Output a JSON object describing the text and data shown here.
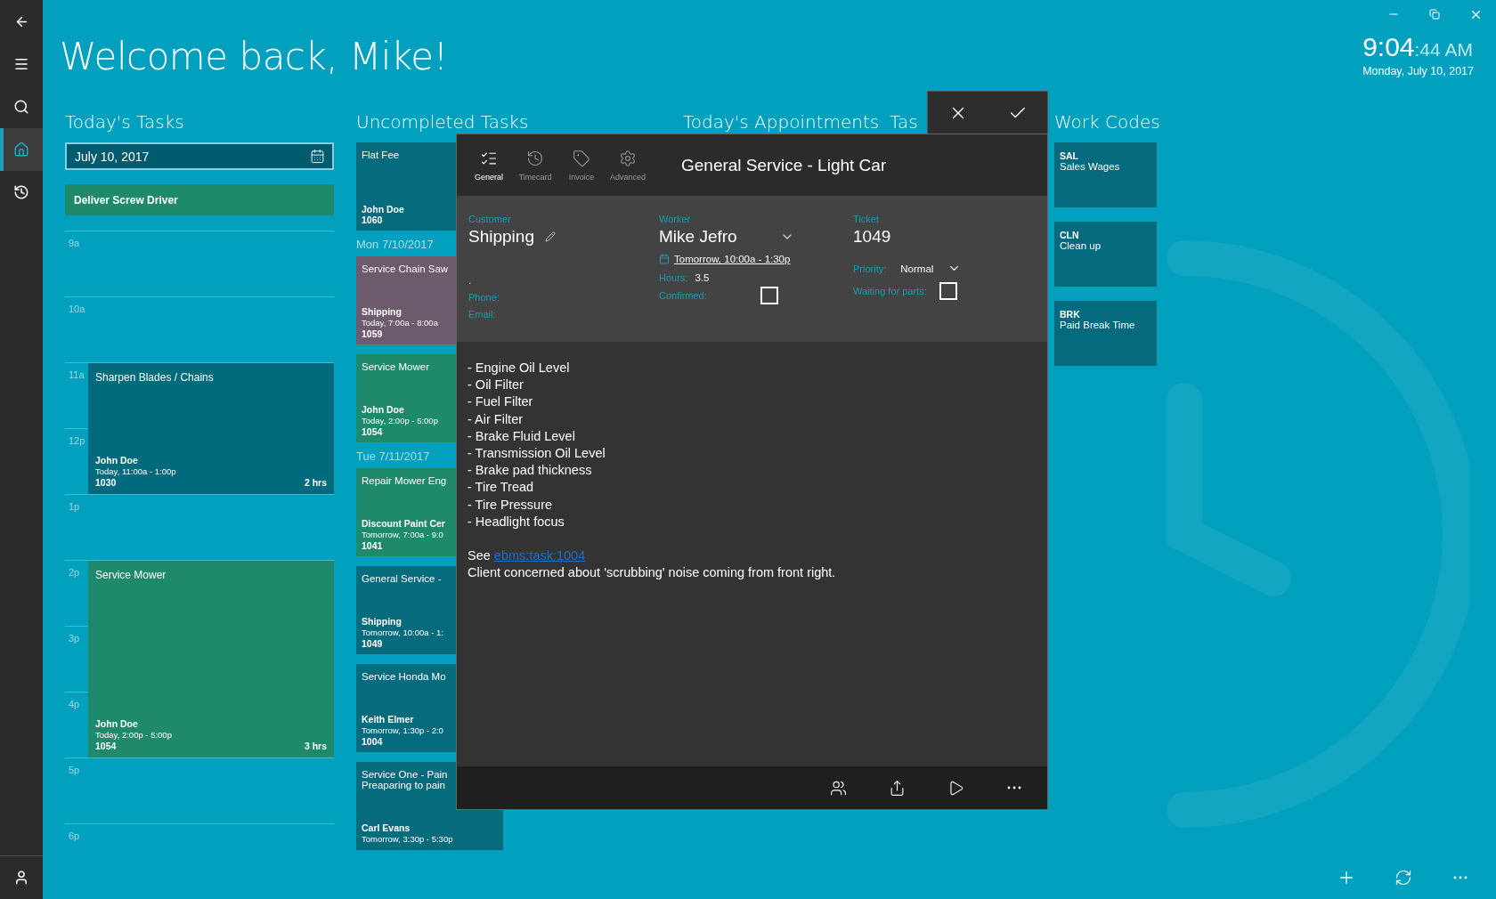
{
  "title": "Welcome back, Mike!",
  "clock": {
    "time": "9:04",
    "seconds": ":44 AM",
    "date": "Monday, July 10, 2017"
  },
  "nav": [
    {
      "selected": false
    },
    {
      "selected": false
    },
    {
      "selected": true
    },
    {
      "selected": false
    }
  ],
  "todays_tasks": {
    "heading": "Today's Tasks",
    "date": "July 10, 2017",
    "all_day": [
      {
        "title": "Deliver Screw Driver",
        "color": "#1f8a6b"
      }
    ],
    "hours": [
      {
        "label": "9a"
      },
      {
        "label": "10a"
      },
      {
        "label": "11a",
        "event": {
          "title": "Sharpen Blades /  Chains",
          "customer": "John Doe",
          "time": "Today, 11:00a - 1:00p",
          "ticket": "1030",
          "duration": "2 hrs",
          "color": "#016a7c"
        }
      },
      {
        "label": "12p",
        "continues": true
      },
      {
        "label": "1p"
      },
      {
        "label": "2p",
        "event": {
          "title": "Service Mower",
          "customer": "John Doe",
          "time": "Today, 2:00p - 5:00p",
          "ticket": "1054",
          "duration": "3 hrs",
          "color": "#1f8a6b"
        }
      },
      {
        "label": "3p",
        "continues": true
      },
      {
        "label": "4p",
        "continues": true
      },
      {
        "label": "5p"
      },
      {
        "label": "6p"
      }
    ]
  },
  "uncompleted_tasks": {
    "heading": "Uncompleted Tasks",
    "groups": [
      {
        "cards": [
          {
            "title": "Flat Fee",
            "customer": "John Doe",
            "ticket": "1060",
            "color": "#076b7e"
          }
        ]
      },
      {
        "heading": "Mon 7/10/2017",
        "cards": [
          {
            "title": "Service Chain Saw",
            "customer": "Shipping",
            "time": "Today, 7:00a - 8:00a",
            "ticket": "1059",
            "color": "#6d5a6c"
          },
          {
            "title": "Service Mower",
            "customer": "John Doe",
            "time": "Today, 2:00p - 5:00p",
            "ticket": "1054",
            "color": "#1f8a6b"
          }
        ]
      },
      {
        "heading": "Tue 7/11/2017",
        "cards": [
          {
            "title": "Repair Mower Eng",
            "customer": "Discount Paint Cer",
            "time": "Tomorrow, 7:00a - 9:0",
            "ticket": "1041",
            "color": "#1f8a6b"
          },
          {
            "title": "General Service -",
            "customer": "Shipping",
            "time": "Tomorrow, 10:00a - 1:",
            "ticket": "1049",
            "color": "#076b7e"
          },
          {
            "title": "Service Honda Mo",
            "customer": "Keith Elmer",
            "time": "Tomorrow, 1:30p - 2:0",
            "ticket": "1004",
            "color": "#076b7e"
          },
          {
            "title": "Service One - Pain",
            "subtitle": "Preaparing to pain",
            "customer": "Carl Evans",
            "time": "Tomorrow, 3:30p - 5:30p",
            "color": "#076b7e"
          }
        ]
      }
    ]
  },
  "appointments": {
    "heading": "Today's Appointments"
  },
  "tasks_column": {
    "heading": "Tas"
  },
  "work_codes": {
    "heading": "Work Codes",
    "items": [
      {
        "code": "SAL",
        "name": "Sales Wages"
      },
      {
        "code": "CLN",
        "name": "Clean up"
      },
      {
        "code": "BRK",
        "name": "Paid Break Time"
      }
    ]
  },
  "dialog": {
    "title": "General Service - Light Car",
    "tabs": [
      {
        "label": "General",
        "selected": true
      },
      {
        "label": "Timecard",
        "selected": false
      },
      {
        "label": "Invoice",
        "selected": false
      },
      {
        "label": "Advanced",
        "selected": false
      }
    ],
    "customer": {
      "label": "Customer",
      "value": "Shipping",
      "address": ".",
      "phone_label": "Phone:",
      "email_label": "Email:"
    },
    "worker": {
      "label": "Worker",
      "value": "Mike Jefro",
      "schedule": "Tomorrow, 10:00a - 1:30p",
      "hours_label": "Hours:",
      "hours": "3.5",
      "confirmed_label": "Confirmed:",
      "confirmed": false
    },
    "ticket": {
      "label": "Ticket",
      "value": "1049",
      "priority_label": "Priority:",
      "priority": "Normal",
      "waiting_label": "Waiting for parts:",
      "waiting": false
    },
    "notes": [
      "- Engine Oil Level",
      "- Oil Filter",
      "- Fuel Filter",
      "- Air Filter",
      "- Brake Fluid Level",
      "- Transmission Oil Level",
      "- Brake pad thickness",
      "- Tire Tread",
      "- Tire Pressure",
      "- Headlight focus"
    ],
    "see": {
      "prefix": "See",
      "link": "ebms:task:1004"
    },
    "comment": "Client concerned about 'scrubbing' noise coming from front right."
  }
}
